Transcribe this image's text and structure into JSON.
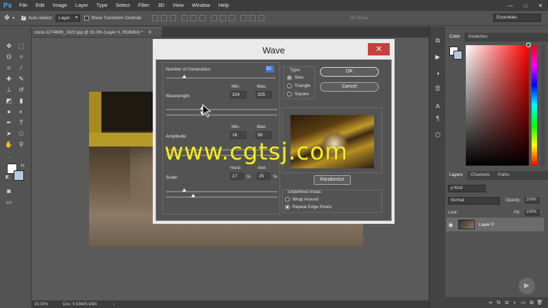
{
  "app": {
    "logo": "Ps",
    "menu": [
      "File",
      "Edit",
      "Image",
      "Layer",
      "Type",
      "Select",
      "Filter",
      "3D",
      "View",
      "Window",
      "Help"
    ],
    "window_controls": [
      "—",
      "□",
      "✕"
    ]
  },
  "options_bar": {
    "auto_select_label": "Auto-Select:",
    "auto_select_value": "Layer",
    "show_transform_label": "Show Transform Controls",
    "mode_3d_label": "3D Mode:",
    "workspace": "Essentials"
  },
  "document": {
    "tab_title": "clock-1274699_1920.jpg @ 33.3% (Layer 0, RGB/8#) *",
    "tab_close": "✕"
  },
  "status_bar": {
    "zoom": "33.33%",
    "doc_size": "Doc: 5.93M/5.93M",
    "arrow": "›"
  },
  "color_panel": {
    "tabs": [
      "Color",
      "Swatches"
    ],
    "fg_color": "#ffffff",
    "bg_color": "#b6c8dc"
  },
  "layers_panel": {
    "tabs": [
      "Layers",
      "Channels",
      "Paths"
    ],
    "kind_filter": "ρ Kind",
    "blend_mode": "Normal",
    "opacity_label": "Opacity:",
    "opacity_value": "100%",
    "lock_label": "Lock:",
    "fill_label": "Fill:",
    "fill_value": "100%",
    "layers": [
      {
        "name": "Layer 0",
        "visible": true
      }
    ]
  },
  "wave_dialog": {
    "title": "Wave",
    "close": "✕",
    "generators_label": "Number of Generators:",
    "generators_value": "82",
    "wavelength_label": "Wavelength:",
    "wavelength_min_label": "Min.",
    "wavelength_max_label": "Max.",
    "wavelength_min": "324",
    "wavelength_max": "325",
    "amplitude_label": "Amplitude:",
    "amplitude_min_label": "Min.",
    "amplitude_max_label": "Max.",
    "amplitude_min": "16",
    "amplitude_max": "56",
    "scale_label": "Scale:",
    "scale_horiz_label": "Horiz.",
    "scale_vert_label": "Vert.",
    "scale_horiz": "17",
    "scale_vert": "25",
    "percent": "%",
    "type_label": "Type:",
    "type_options": [
      "Sine",
      "Triangle",
      "Square"
    ],
    "type_selected": "Sine",
    "ok_label": "OK",
    "cancel_label": "Cancel",
    "randomize_label": "Randomize",
    "undefined_label": "Undefined Areas:",
    "undefined_options": [
      "Wrap Around",
      "Repeat Edge Pixels"
    ],
    "undefined_selected": "Repeat Edge Pixels"
  },
  "watermark": "www.cgtsj.com"
}
